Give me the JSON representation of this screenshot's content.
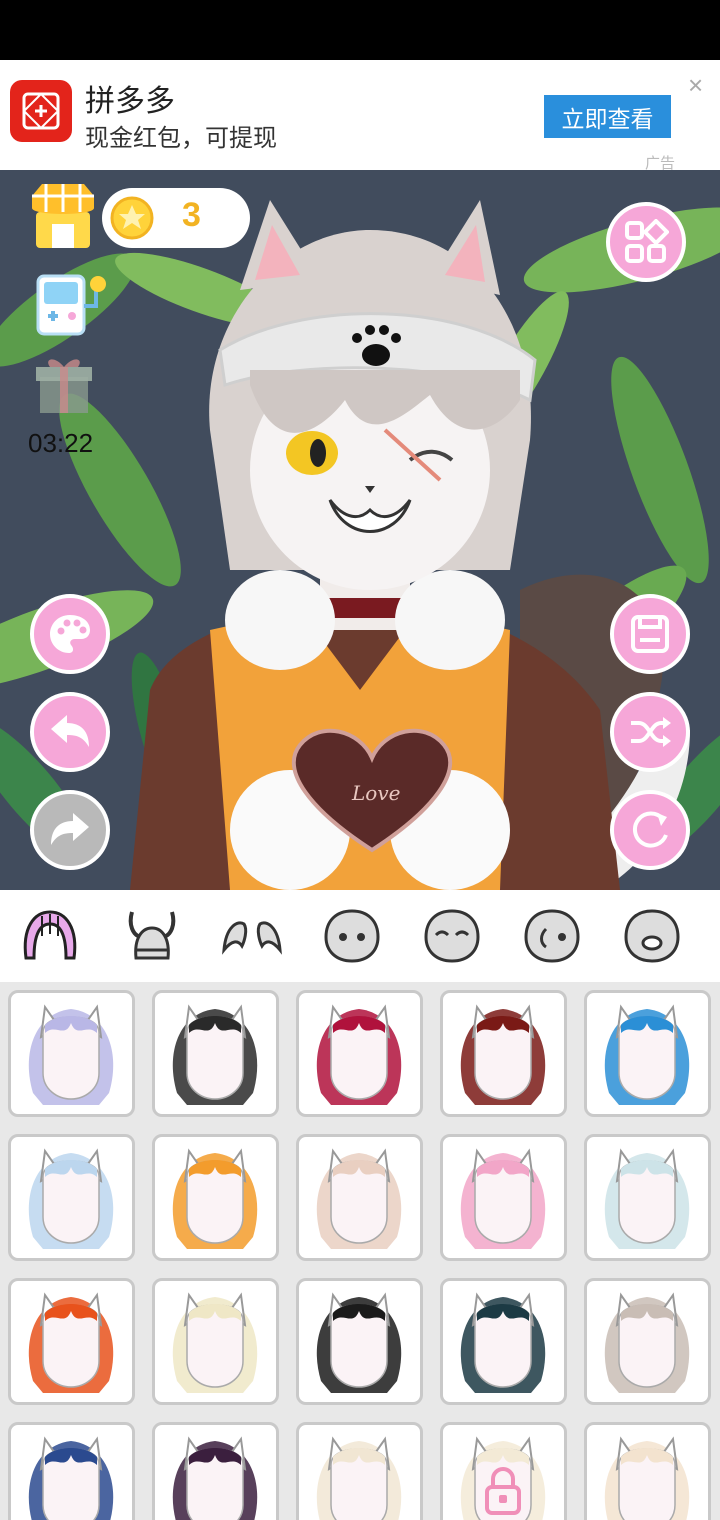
{
  "ad": {
    "app_name": "拼多多",
    "subtitle": "现金红包，可提现",
    "cta_label": "立即查看",
    "close_glyph": "×",
    "tag": "广告"
  },
  "canvas": {
    "coins": "3",
    "timer": "03:22",
    "heart_text": "Love"
  },
  "categories": [
    "hair",
    "headwear",
    "ears",
    "face-shape",
    "eyes-closed",
    "side-face",
    "mouth"
  ],
  "hair_tiles": [
    {
      "color": "#b9b7e6",
      "locked": false
    },
    {
      "color": "#2a2a2a",
      "locked": false
    },
    {
      "color": "#b0123c",
      "locked": false
    },
    {
      "color": "#7a1a16",
      "locked": false
    },
    {
      "color": "#2b8fd6",
      "locked": false
    },
    {
      "color": "#bcd6ee",
      "locked": false
    },
    {
      "color": "#f39c2c",
      "locked": false
    },
    {
      "color": "#e9cfc1",
      "locked": false
    },
    {
      "color": "#f2a6c8",
      "locked": false
    },
    {
      "color": "#cde3e8",
      "locked": false
    },
    {
      "color": "#e8521c",
      "locked": false
    },
    {
      "color": "#efe7c6",
      "locked": false
    },
    {
      "color": "#1b1b1b",
      "locked": false
    },
    {
      "color": "#1c3a44",
      "locked": false
    },
    {
      "color": "#c9bdb5",
      "locked": false
    },
    {
      "color": "#2b4a8f",
      "locked": false
    },
    {
      "color": "#3b1f3e",
      "locked": false
    },
    {
      "color": "#f1e6d3",
      "locked": false
    },
    {
      "color": "#f3ead6",
      "locked": true
    },
    {
      "color": "#f3e3cf",
      "locked": false
    }
  ],
  "colors": {
    "accent_pink": "#f6a7d8",
    "ad_red": "#e3241b",
    "ad_blue": "#2a8fdc",
    "coin_gold": "#f2b322"
  }
}
